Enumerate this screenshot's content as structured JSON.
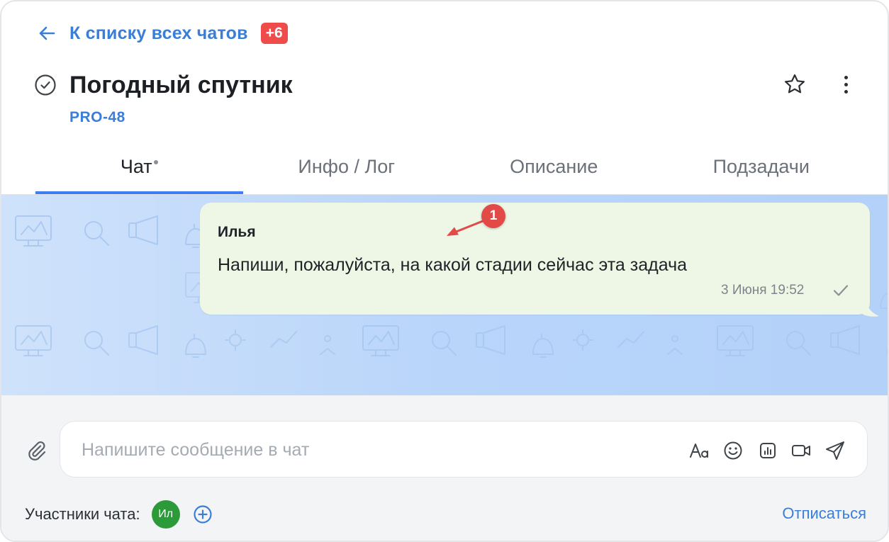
{
  "header": {
    "back_label": "К списку всех чатов",
    "unread_badge": "+6",
    "title": "Погодный спутник",
    "task_id": "PRO-48"
  },
  "tabs": [
    {
      "label": "Чат",
      "active": true,
      "has_dot": true
    },
    {
      "label": "Инфо / Лог",
      "active": false
    },
    {
      "label": "Описание",
      "active": false
    },
    {
      "label": "Подзадачи",
      "active": false
    }
  ],
  "message": {
    "author": "Илья",
    "text": "Напиши, пожалуйста, на какой стадии сейчас эта задача",
    "time": "3 Июня 19:52",
    "status_icon": "check-icon"
  },
  "annotation": {
    "number": "1"
  },
  "composer": {
    "placeholder": "Напишите сообщение в чат",
    "value": "",
    "tools": [
      "text-format-icon",
      "emoji-icon",
      "poll-icon",
      "video-icon",
      "send-icon"
    ]
  },
  "footer": {
    "participants_label": "Участники чата:",
    "participants": [
      {
        "initials": "Ил",
        "color": "#2d9a3a"
      }
    ],
    "unsubscribe_label": "Отписаться"
  },
  "colors": {
    "accent": "#3a7ed8",
    "tab_indicator": "#3d7ef5",
    "badge": "#ef4b4b",
    "bubble": "#eef6e5",
    "annotation": "#e24a48"
  }
}
